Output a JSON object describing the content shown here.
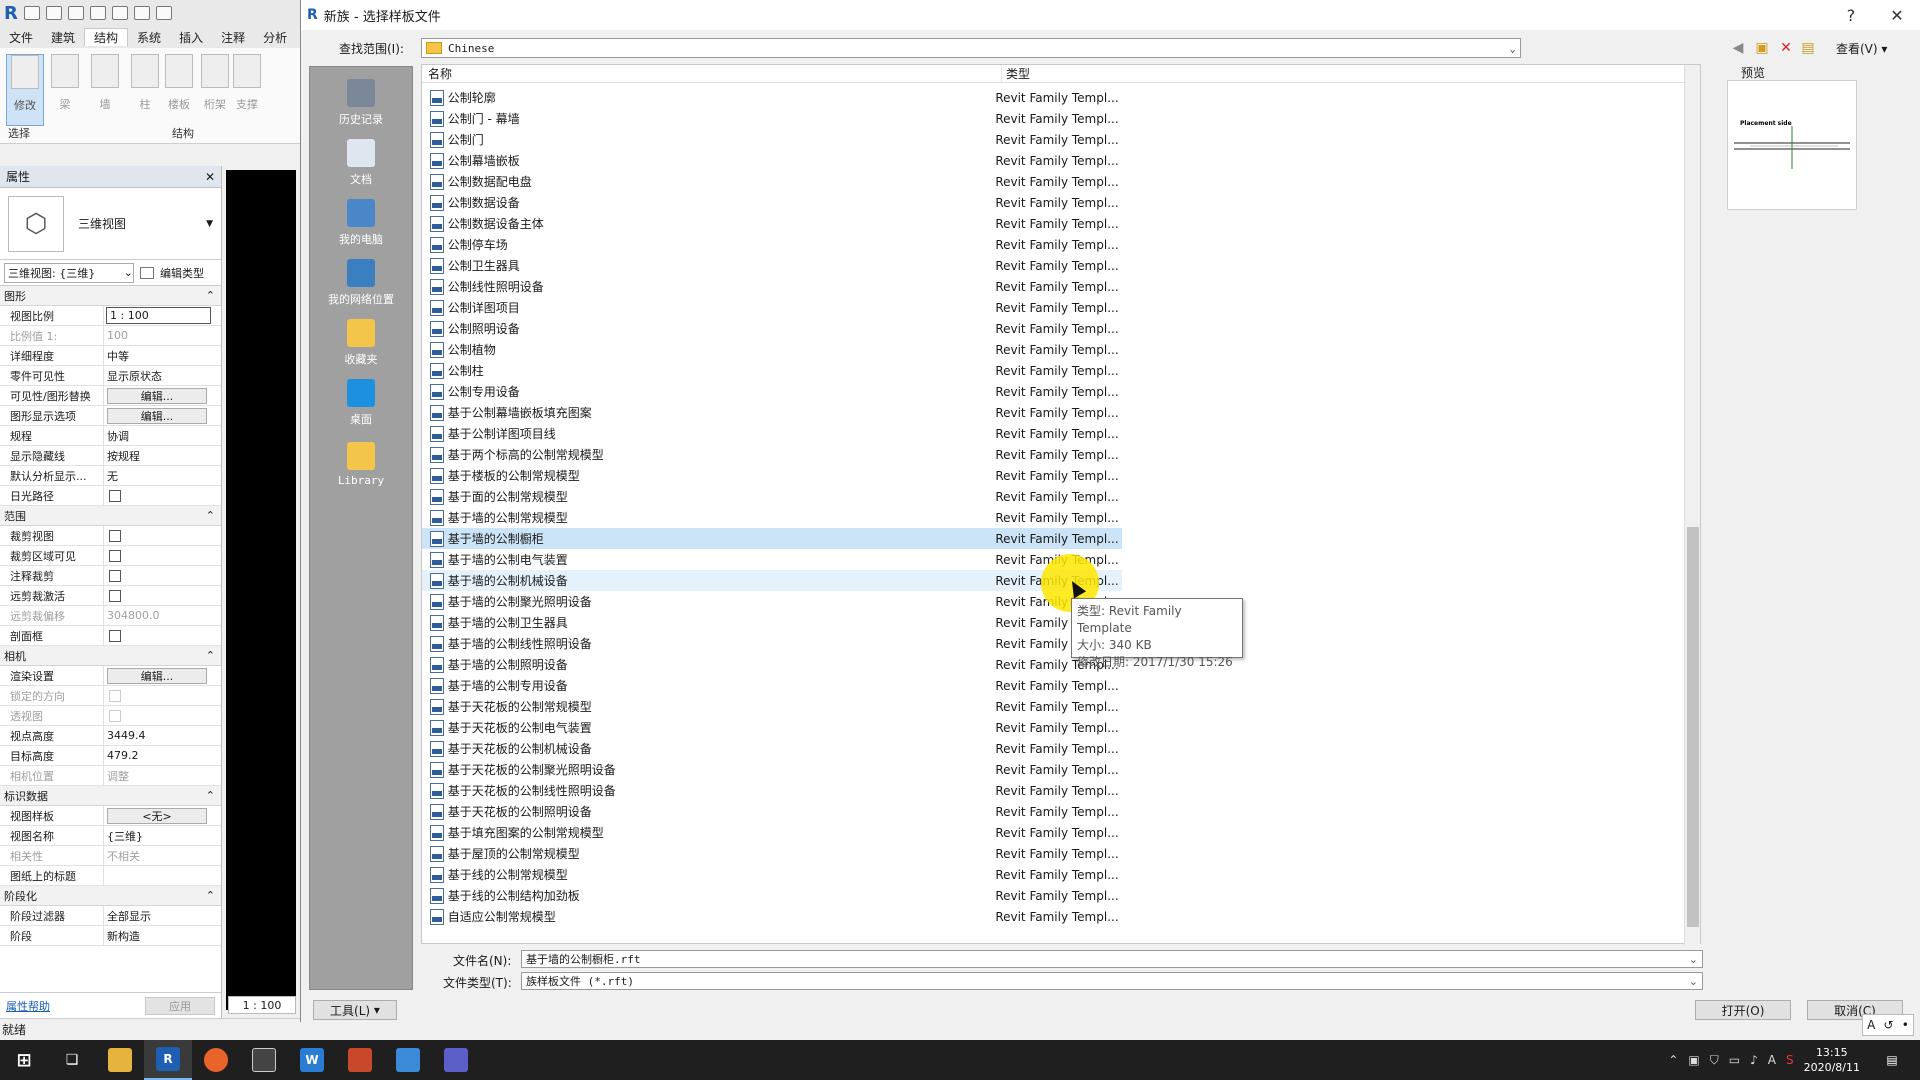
{
  "revit": {
    "ribbon_tabs": [
      "文件",
      "建筑",
      "结构",
      "系统",
      "插入",
      "注释",
      "分析"
    ],
    "active_tab": "结构",
    "ribbon_buttons": [
      "修改",
      "梁",
      "墙",
      "柱",
      "楼板",
      "桁架",
      "支撑"
    ],
    "group_select": "选择",
    "group_structure": "结构"
  },
  "props": {
    "title": "属性",
    "type_name": "三维视图",
    "selector": "三维视图: {三维}",
    "edit_type": "编辑类型",
    "sections": {
      "graphics": "图形",
      "extents": "范围",
      "camera": "相机",
      "identity": "标识数据",
      "phasing": "阶段化"
    },
    "graphics_rows": [
      {
        "k": "视图比例",
        "v": "1 : 100"
      },
      {
        "k": "比例值 1:",
        "v": "100"
      },
      {
        "k": "详细程度",
        "v": "中等"
      },
      {
        "k": "零件可见性",
        "v": "显示原状态"
      },
      {
        "k": "可见性/图形替换",
        "v": "编辑..."
      },
      {
        "k": "图形显示选项",
        "v": "编辑..."
      },
      {
        "k": "规程",
        "v": "协调"
      },
      {
        "k": "显示隐藏线",
        "v": "按规程"
      },
      {
        "k": "默认分析显示...",
        "v": "无"
      },
      {
        "k": "日光路径",
        "v": ""
      }
    ],
    "extents_rows": [
      {
        "k": "裁剪视图",
        "v": ""
      },
      {
        "k": "裁剪区域可见",
        "v": ""
      },
      {
        "k": "注释裁剪",
        "v": ""
      },
      {
        "k": "远剪裁激活",
        "v": ""
      },
      {
        "k": "远剪裁偏移",
        "v": "304800.0"
      },
      {
        "k": "剖面框",
        "v": ""
      }
    ],
    "camera_rows": [
      {
        "k": "渲染设置",
        "v": "编辑..."
      },
      {
        "k": "锁定的方向",
        "v": ""
      },
      {
        "k": "透视图",
        "v": ""
      },
      {
        "k": "视点高度",
        "v": "3449.4"
      },
      {
        "k": "目标高度",
        "v": "479.2"
      },
      {
        "k": "相机位置",
        "v": "调整"
      }
    ],
    "identity_rows": [
      {
        "k": "视图样板",
        "v": "<无>"
      },
      {
        "k": "视图名称",
        "v": "{三维}"
      },
      {
        "k": "相关性",
        "v": "不相关"
      },
      {
        "k": "图纸上的标题",
        "v": ""
      }
    ],
    "phasing_rows": [
      {
        "k": "阶段过滤器",
        "v": "全部显示"
      },
      {
        "k": "阶段",
        "v": "新构造"
      }
    ],
    "help_link": "属性帮助",
    "apply": "应用"
  },
  "scale_label": "1 : 100",
  "status": "就绪",
  "dialog": {
    "title": "新族 - 选择样板文件",
    "help": "?",
    "close": "✕",
    "lookin_label": "查找范围(I):",
    "lookin_value": "Chinese",
    "view_menu": "查看(V)",
    "places": [
      "历史记录",
      "文档",
      "我的电脑",
      "我的网络位置",
      "收藏夹",
      "桌面",
      "Library"
    ],
    "col_name": "名称",
    "col_type": "类型",
    "files": [
      "公制轮廓",
      "公制门 - 幕墙",
      "公制门",
      "公制幕墙嵌板",
      "公制数据配电盘",
      "公制数据设备",
      "公制数据设备主体",
      "公制停车场",
      "公制卫生器具",
      "公制线性照明设备",
      "公制详图项目",
      "公制照明设备",
      "公制植物",
      "公制柱",
      "公制专用设备",
      "基于公制幕墙嵌板填充图案",
      "基于公制详图项目线",
      "基于两个标高的公制常规模型",
      "基于楼板的公制常规模型",
      "基于面的公制常规模型",
      "基于墙的公制常规模型",
      "基于墙的公制橱柜",
      "基于墙的公制电气装置",
      "基于墙的公制机械设备",
      "基于墙的公制聚光照明设备",
      "基于墙的公制卫生器具",
      "基于墙的公制线性照明设备",
      "基于墙的公制照明设备",
      "基于墙的公制专用设备",
      "基于天花板的公制常规模型",
      "基于天花板的公制电气装置",
      "基于天花板的公制机械设备",
      "基于天花板的公制聚光照明设备",
      "基于天花板的公制线性照明设备",
      "基于天花板的公制照明设备",
      "基于填充图案的公制常规模型",
      "基于屋顶的公制常规模型",
      "基于线的公制常规模型",
      "基于线的公制结构加劲板",
      "自适应公制常规模型"
    ],
    "file_type": "Revit Family Templ...",
    "selected_index": 21,
    "hover_index": 23,
    "tooltip": {
      "type": "类型: Revit Family Template",
      "size": "大小: 340 KB",
      "date": "修改日期: 2017/1/30 15:26"
    },
    "preview_label": "预览",
    "preview_caption": "Placement side",
    "filename_label": "文件名(N):",
    "filename_value": "基于墙的公制橱柜.rft",
    "filetype_label": "文件类型(T):",
    "filetype_value": "族样板文件 (*.rft)",
    "tools": "工具(L)",
    "open": "打开(O)",
    "cancel": "取消(C)"
  },
  "taskbar": {
    "time": "13:15",
    "date": "2020/8/11"
  },
  "colors": {
    "selected_row": "#cce4f7",
    "highlight": "#ffe600",
    "places_bg": "#a0a0a0"
  }
}
